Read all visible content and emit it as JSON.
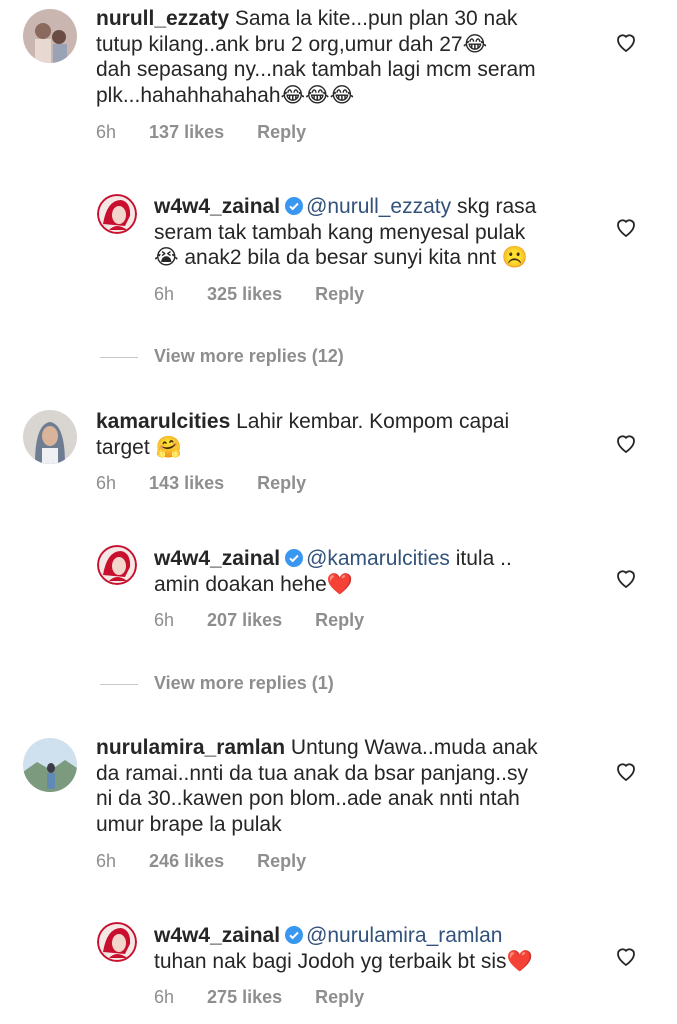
{
  "comments": [
    {
      "username": "nurull_ezzaty",
      "text_lines": [
        "Sama la kite...pun plan 30 nak",
        "tutup kilang..ank bru 2 org,umur dah 27😂",
        "dah sepasang ny...nak tambah lagi mcm seram",
        "plk...hahahhahahah😂😂😂"
      ],
      "time": "6h",
      "likes": "137 likes",
      "reply": "Reply"
    },
    {
      "username": "w4w4_zainal",
      "mention": "@nurull_ezzaty",
      "text_lines": [
        " skg rasa",
        "seram tak tambah kang menyesal pulak",
        "😭 anak2 bila da besar sunyi kita nnt ☹️"
      ],
      "time": "6h",
      "likes": "325 likes",
      "reply": "Reply"
    },
    {
      "username": "kamarulcities",
      "text_lines": [
        " Lahir kembar. Kompom capai",
        "target 🤗"
      ],
      "time": "6h",
      "likes": "143 likes",
      "reply": "Reply"
    },
    {
      "username": "w4w4_zainal",
      "mention": "@kamarulcities",
      "text_lines": [
        " itula ..",
        "amin doakan hehe❤️"
      ],
      "time": "6h",
      "likes": "207 likes",
      "reply": "Reply"
    },
    {
      "username": "nurulamira_ramlan",
      "text_lines": [
        " Untung Wawa..muda anak",
        "da ramai..nnti da tua anak da bsar panjang..sy",
        "ni da 30..kawen pon blom..ade anak nnti ntah",
        "umur brape la pulak"
      ],
      "time": "6h",
      "likes": "246 likes",
      "reply": "Reply"
    },
    {
      "username": "w4w4_zainal",
      "mention": "@nurulamira_ramlan",
      "text_lines": [
        "tuhan nak bagi Jodoh yg terbaik bt sis❤️"
      ],
      "time": "6h",
      "likes": "275 likes",
      "reply": "Reply"
    }
  ],
  "view_more": [
    "View more replies (12)",
    "View more replies (1)"
  ],
  "colors": {
    "text": "#262626",
    "meta": "#8e8e8e",
    "mention": "#32527b",
    "verified": "#3897f0"
  }
}
